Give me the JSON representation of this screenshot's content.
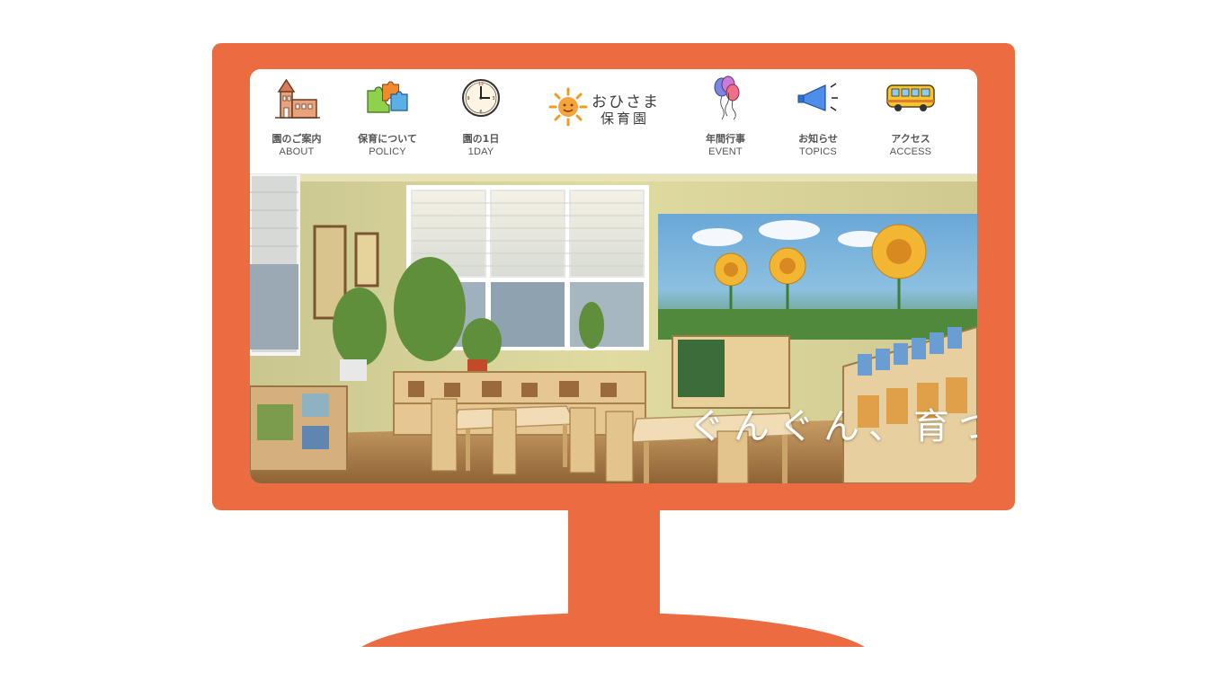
{
  "colors": {
    "frame": "#ec6c41",
    "nav_text": "#555555",
    "hero_caption": "#ffffff"
  },
  "nav": {
    "items": [
      {
        "jp": "園のご案内",
        "en": "ABOUT",
        "icon": "school-building-icon"
      },
      {
        "jp": "保育について",
        "en": "POLICY",
        "icon": "puzzle-icon"
      },
      {
        "jp": "園の1日",
        "en": "1DAY",
        "icon": "clock-icon"
      },
      {
        "jp": "年間行事",
        "en": "EVENT",
        "icon": "balloons-icon"
      },
      {
        "jp": "お知らせ",
        "en": "TOPICS",
        "icon": "megaphone-icon"
      },
      {
        "jp": "アクセス",
        "en": "ACCESS",
        "icon": "bus-icon"
      }
    ]
  },
  "logo": {
    "line1": "おひさま",
    "line2": "保育園",
    "icon": "sun-icon"
  },
  "hero": {
    "caption": "ぐんぐん、育つ",
    "image": "classroom-photo"
  }
}
